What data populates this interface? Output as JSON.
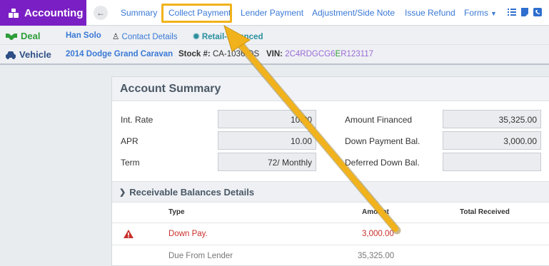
{
  "app": {
    "title": "Accounting"
  },
  "nav": {
    "links": [
      "Summary",
      "Collect Payment",
      "Lender Payment",
      "Adjustment/Side Note",
      "Issue Refund",
      "Forms"
    ]
  },
  "deal": {
    "label": "Deal",
    "customer": "Han Solo",
    "contact": "Contact Details",
    "status": "Retail-Financed"
  },
  "vehicle": {
    "label": "Vehicle",
    "name": "2014 Dodge Grand Caravan",
    "stock_label": "Stock #:",
    "stock": "CA-1036-DS",
    "vin_label": "VIN:",
    "vin_part1": "2C4RDGCG6",
    "vin_part2": "E",
    "vin_part3": "R123117"
  },
  "summary": {
    "title": "Account Summary",
    "int_rate_label": "Int. Rate",
    "int_rate": "10.00",
    "apr_label": "APR",
    "apr": "10.00",
    "term_label": "Term",
    "term": "72/ Monthly",
    "amount_financed_label": "Amount Financed",
    "amount_financed": "35,325.00",
    "down_payment_label": "Down Payment Bal.",
    "down_payment": "3,000.00",
    "deferred_label": "Deferred Down Bal.",
    "deferred": ""
  },
  "receivables": {
    "title": "Receivable Balances Details",
    "columns": [
      "Type",
      "Amount",
      "Total Received"
    ],
    "rows": [
      {
        "type": "Down Pay.",
        "amount": "3,000.00",
        "received": ""
      },
      {
        "type": "Due From Lender",
        "amount": "35,325.00",
        "received": ""
      }
    ]
  },
  "colors": {
    "brand": "#7a1fc4",
    "link": "#3a79d6",
    "highlight": "#f1b21b",
    "warning": "#c9302c"
  }
}
